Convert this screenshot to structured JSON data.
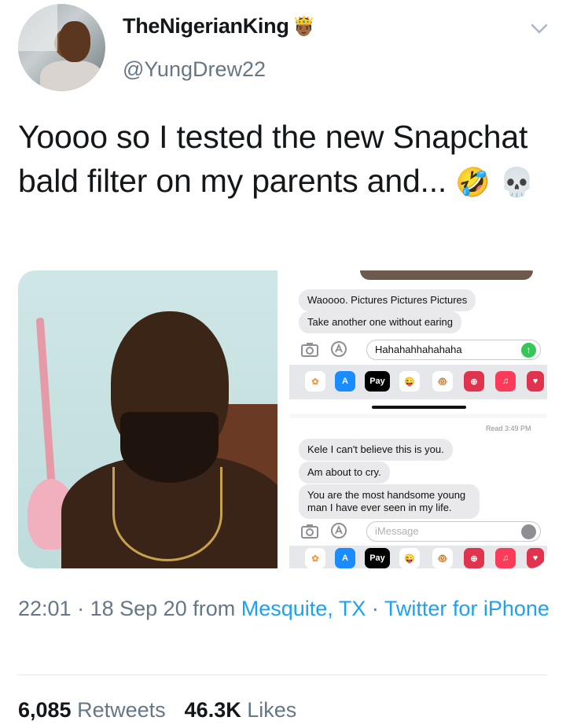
{
  "user": {
    "display_name": "TheNigerianKing",
    "handle": "@YungDrew22",
    "name_emoji": "🤴🏾"
  },
  "tweet": {
    "text": "Yoooo so I tested the new Snapchat bald filter on my parents and...",
    "emojis": [
      "🤣",
      "💀"
    ]
  },
  "imessage_top": {
    "bubbles": [
      "Waoooo. Pictures Pictures Pictures",
      "Take another one without earing"
    ],
    "input_value": "Hahahahhahahaha",
    "apps": [
      "Photos",
      "App Store",
      "Apple Pay",
      "Memoji",
      "Animoji",
      "Search",
      "Music"
    ],
    "apple_pay_label": "Pay"
  },
  "imessage_bottom": {
    "read_receipt": "Read 3:49 PM",
    "bubbles": [
      "Kele I can't believe this is you.",
      "Am about to cry.",
      "You are the most handsome young man I have ever seen in my life."
    ],
    "input_placeholder": "iMessage",
    "apple_pay_label": "Pay"
  },
  "meta": {
    "time": "22:01",
    "date": "18 Sep 20",
    "from_label": "from",
    "location": "Mesquite, TX",
    "separator": "·",
    "source": "Twitter for iPhone"
  },
  "stats": {
    "retweets_count": "6,085",
    "retweets_label": "Retweets",
    "likes_count": "46.3K",
    "likes_label": "Likes"
  },
  "colors": {
    "link": "#1da1f2",
    "secondary_text": "#657786",
    "imessage_send": "#34c759"
  }
}
